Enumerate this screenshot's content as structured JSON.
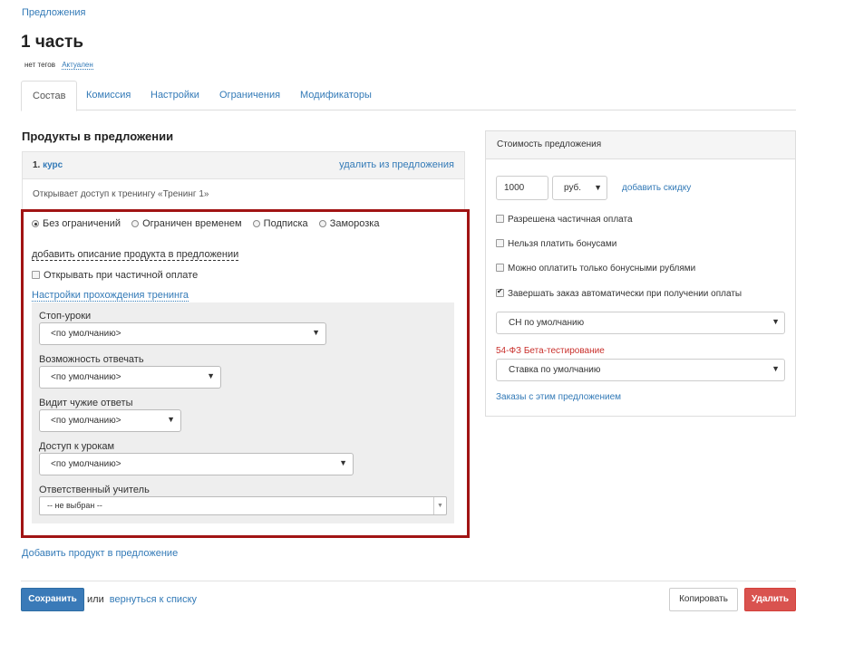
{
  "breadcrumb": "Предложения",
  "page_title": "1 часть",
  "tags_text": "нет тегов",
  "status_link": "Актуален",
  "tabs": [
    {
      "label": "Состав"
    },
    {
      "label": "Комиссия"
    },
    {
      "label": "Настройки"
    },
    {
      "label": "Ограничения"
    },
    {
      "label": "Модификаторы"
    }
  ],
  "section_title": "Продукты в предложении",
  "product": {
    "number": "1.",
    "name": "курс",
    "remove_link": "удалить из предложения",
    "description": "Открывает доступ к тренингу «Тренинг 1»",
    "radio_options": [
      {
        "label": "Без ограничений",
        "checked": true
      },
      {
        "label": "Ограничен временем",
        "checked": false
      },
      {
        "label": "Подписка",
        "checked": false
      },
      {
        "label": "Заморозка",
        "checked": false
      }
    ],
    "add_description_link": "добавить описание продукта в предложении",
    "partial_payment_checkbox": "Открывать при частичной оплате",
    "training_settings_link": "Настройки прохождения тренинга",
    "settings": {
      "stop_lessons_label": "Стоп-уроки",
      "stop_lessons_value": "<по умолчанию>",
      "can_answer_label": "Возможность отвечать",
      "can_answer_value": "<по умолчанию>",
      "sees_answers_label": "Видит чужие ответы",
      "sees_answers_value": "<по умолчанию>",
      "lesson_access_label": "Доступ к урокам",
      "lesson_access_value": "<по умолчанию>",
      "teacher_label": "Ответственный учитель",
      "teacher_value": "-- не выбран --"
    }
  },
  "add_product_link": "Добавить продукт в предложение",
  "footer": {
    "save": "Сохранить",
    "or": "или",
    "back_link": "вернуться к списку",
    "copy": "Копировать",
    "delete": "Удалить"
  },
  "price_panel": {
    "title": "Стоимость предложения",
    "price": "1000",
    "currency": "руб.",
    "add_discount": "добавить скидку",
    "checks": [
      {
        "label": "Разрешена частичная оплата",
        "checked": false
      },
      {
        "label": "Нельзя платить бонусами",
        "checked": false
      },
      {
        "label": "Можно оплатить только бонусными рублями",
        "checked": false
      },
      {
        "label": "Завершать заказ автоматически при получении оплаты",
        "checked": true
      }
    ],
    "tax_system": "СН по умолчанию",
    "fz_label": "54-ФЗ Бета-тестирование",
    "vat_rate": "Ставка по умолчанию",
    "orders_link": "Заказы с этим предложением"
  },
  "colors": {
    "link": "#337ab7",
    "primary": "#3a7ab8",
    "danger": "#d9534f",
    "highlight_frame": "#a11414",
    "fz_label": "#c9302c"
  }
}
